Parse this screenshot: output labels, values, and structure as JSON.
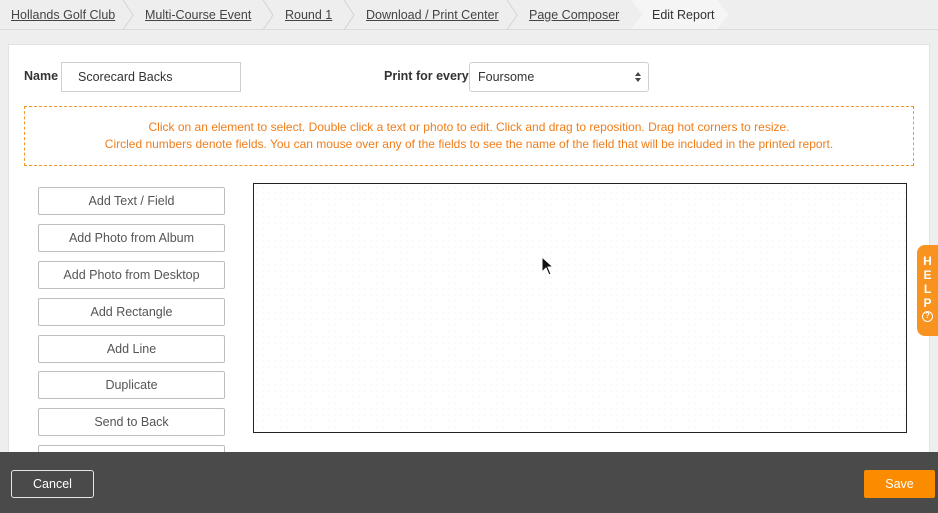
{
  "breadcrumb": [
    {
      "label": "Hollands Golf Club"
    },
    {
      "label": "Multi-Course Event"
    },
    {
      "label": "Round 1"
    },
    {
      "label": "Download / Print Center"
    },
    {
      "label": "Page Composer"
    },
    {
      "label": "Edit Report"
    }
  ],
  "form": {
    "name_label": "Name",
    "name_value": "Scorecard Backs",
    "print_label": "Print for every",
    "print_value": "Foursome"
  },
  "instructions": {
    "line1": "Click on an element to select. Double click a text or photo to edit. Click and drag to reposition. Drag hot corners to resize.",
    "line2": "Circled numbers denote fields. You can mouse over any of the fields to see the name of the field that will be included in the printed report."
  },
  "tools": [
    {
      "label": "Add Text / Field"
    },
    {
      "label": "Add Photo from Album"
    },
    {
      "label": "Add Photo from Desktop"
    },
    {
      "label": "Add Rectangle"
    },
    {
      "label": "Add Line"
    },
    {
      "label": "Duplicate"
    },
    {
      "label": "Send to Back"
    },
    {
      "label": ""
    }
  ],
  "help": {
    "letters": [
      "H",
      "E",
      "L",
      "P"
    ],
    "question": "?"
  },
  "footer": {
    "cancel_label": "Cancel",
    "save_label": "Save"
  },
  "colors": {
    "accent": "#fb8c00",
    "info": "#f07d1a",
    "footer_bg": "#4a4a4a"
  }
}
